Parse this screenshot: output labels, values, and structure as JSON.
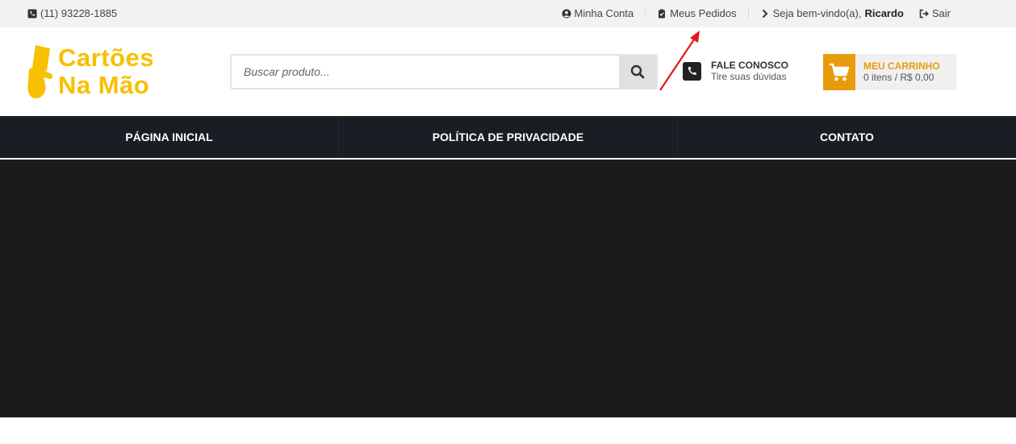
{
  "topbar": {
    "phone": "(11) 93228-1885",
    "my_account": "Minha Conta",
    "my_orders": "Meus Pedidos",
    "welcome_prefix": "Seja bem-vindo(a),",
    "user_name": "Ricardo",
    "logout": "Sair"
  },
  "logo": {
    "line1": "Cartões",
    "line2": "Na Mão"
  },
  "search": {
    "placeholder": "Buscar produto...",
    "value": ""
  },
  "contact": {
    "title": "FALE CONOSCO",
    "subtitle": "Tire suas dúvidas"
  },
  "cart": {
    "title": "MEU CARRINHO",
    "summary": "0 itens / R$ 0,00"
  },
  "nav": {
    "items": [
      "PÁGINA INICIAL",
      "POLÍTICA DE PRIVACIDADE",
      "CONTATO"
    ]
  },
  "colors": {
    "accent": "#e89b0b",
    "logo": "#f7c000",
    "nav_bg": "#1b1d24",
    "banner_bg": "#1b1b1b",
    "annotation": "#e8141b"
  },
  "icons": {
    "phone": "phone-icon",
    "account": "user-circle-icon",
    "orders": "clipboard-check-icon",
    "welcome": "chevron-right-icon",
    "logout": "sign-out-icon",
    "search": "search-icon",
    "contact": "phone-square-icon",
    "cart": "shopping-cart-icon"
  }
}
